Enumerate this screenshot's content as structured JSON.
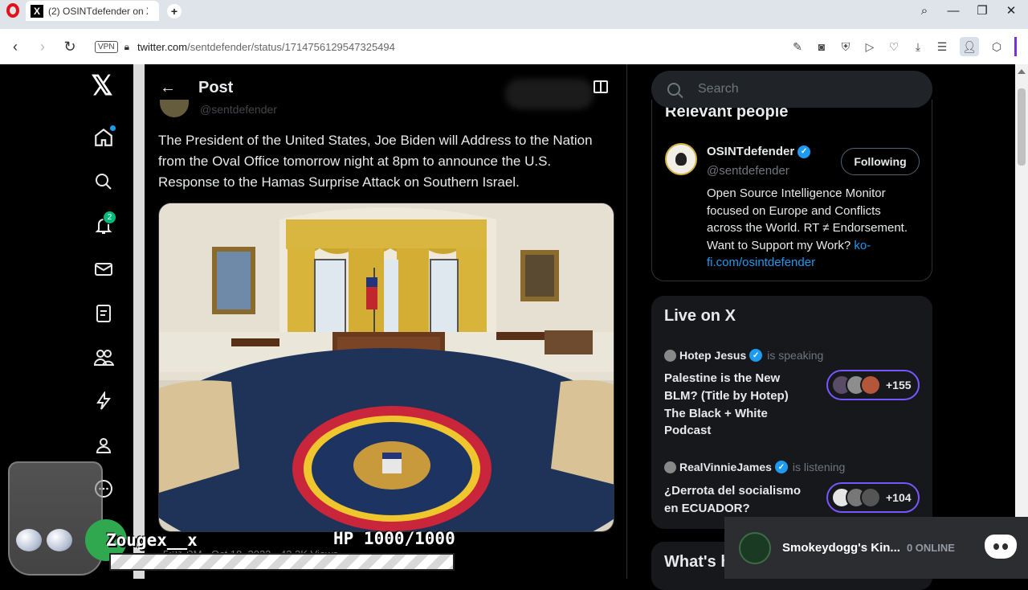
{
  "browser": {
    "tab_title": "(2) OSINTdefender on X: \"",
    "url_domain": "twitter.com",
    "url_path": "/sentdefender/status/1714756129547325494",
    "vpn_label": "VPN"
  },
  "nav": {
    "badge_count": "2"
  },
  "post": {
    "header_title": "Post",
    "handle_partial": "@sentdefender",
    "text": "The President of the United States, Joe Biden will Address to the Nation from the Oval Office tomorrow night at 8pm to announce the U.S. Response to the Hamas Surprise Attack on Southern Israel.",
    "meta_partial": "5:21 PM · Oct 18, 2023 · 43.2K Views"
  },
  "search": {
    "placeholder": "Search"
  },
  "relevant": {
    "title": "Relevant people",
    "name": "OSINTdefender",
    "handle": "@sentdefender",
    "follow_label": "Following",
    "bio": "Open Source Intelligence Monitor focused on Europe and Conflicts across the World. RT ≠ Endorsement. Want to Support my Work? ",
    "bio_link": "ko-fi.com/osintdefender"
  },
  "live": {
    "title": "Live on X",
    "spaces": [
      {
        "host": "Hotep Jesus",
        "status": "is speaking",
        "topic": "Palestine is the New BLM? (Title by Hotep) The Black + White Podcast",
        "count": "+155"
      },
      {
        "host": "RealVinnieJames",
        "status": "is listening",
        "topic": "¿Derrota del socialismo en ECUADOR?",
        "count": "+104"
      }
    ]
  },
  "happening": {
    "title": "What's happening"
  },
  "discord": {
    "server": "Smokeydogg's Kin...",
    "online": "0 ONLINE"
  },
  "overlay": {
    "player_name": "Zougex__x",
    "hp": "HP 1000/1000"
  },
  "icons": [
    "opera-icon",
    "x-logo-icon",
    "home-icon",
    "explore-icon",
    "notifications-icon",
    "messages-icon",
    "lists-icon",
    "communities-icon",
    "premium-icon",
    "profile-icon",
    "more-icon",
    "back-arrow-icon",
    "reader-icon",
    "search-icon",
    "verified-icon",
    "discord-icon"
  ],
  "colors": {
    "accent": "#1d9bf0",
    "verified": "#1d9bf0",
    "space_ring": "#7856ff",
    "badge": "#00ba7c"
  }
}
